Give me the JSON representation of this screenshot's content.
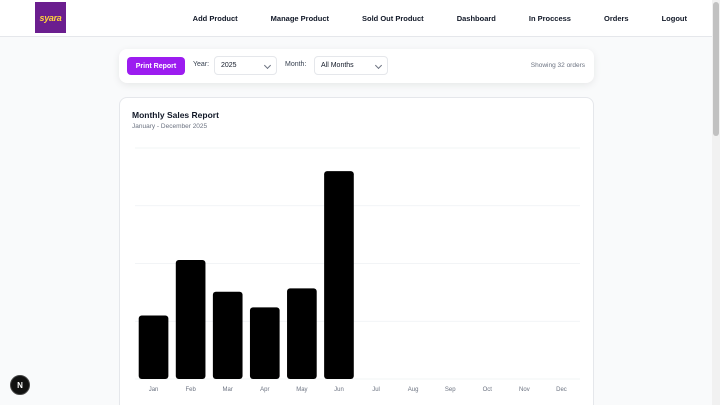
{
  "nav": {
    "logo_text": "syara",
    "links": [
      "Add Product",
      "Manage Product",
      "Sold Out Product",
      "Dashboard",
      "In Proccess",
      "Orders",
      "Logout"
    ]
  },
  "filters": {
    "print_label": "Print Report",
    "year_label": "Year:",
    "year_value": "2025",
    "month_label": "Month:",
    "month_value": "All Months",
    "showing_text": "Showing 32 orders"
  },
  "card": {
    "title": "Monthly Sales Report",
    "subtitle": "January - December 2025"
  },
  "colors": {
    "accent": "#9c1cf0",
    "logo_bg": "#6b1e8f",
    "bar": "#000000"
  },
  "fab_label": "N",
  "chart_data": {
    "type": "bar",
    "categories": [
      "Jan",
      "Feb",
      "Mar",
      "Apr",
      "May",
      "Jun",
      "Jul",
      "Aug",
      "Sep",
      "Oct",
      "Nov",
      "Dec"
    ],
    "values": [
      11,
      20.6,
      15.1,
      12.4,
      15.7,
      36,
      0,
      0,
      0,
      0,
      0,
      0
    ],
    "ylim": [
      0,
      40
    ],
    "grid": true,
    "title": "",
    "xlabel": "",
    "ylabel": ""
  }
}
